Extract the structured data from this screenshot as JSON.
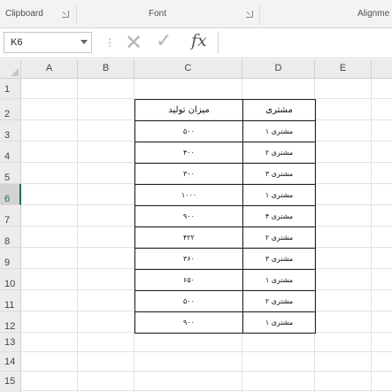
{
  "ribbon": {
    "groups": [
      "Clipboard",
      "Font",
      "Alignme"
    ]
  },
  "formula_bar": {
    "name_box": "K6",
    "cancel_symbol": "✕",
    "enter_symbol": "✓",
    "fx_label": "fx",
    "content": ""
  },
  "grid": {
    "columns": [
      "A",
      "B",
      "C",
      "D",
      "E"
    ],
    "rows": [
      "1",
      "2",
      "3",
      "4",
      "5",
      "6",
      "7",
      "8",
      "9",
      "10",
      "11",
      "12",
      "13",
      "14",
      "15"
    ],
    "active_row": "6"
  },
  "table": {
    "headers": {
      "production": "میزان تولید",
      "customer": "مشتری"
    },
    "rows": [
      {
        "production": "۵۰۰",
        "customer": "مشتری ۱"
      },
      {
        "production": "۴۰۰",
        "customer": "مشتری ۲"
      },
      {
        "production": "۳۰۰",
        "customer": "مشتری ۳"
      },
      {
        "production": "۱۰۰۰",
        "customer": "مشتری ۱"
      },
      {
        "production": "۹۰۰",
        "customer": "مشتری ۴"
      },
      {
        "production": "۴۲۲",
        "customer": "مشتری ۲"
      },
      {
        "production": "۳۶۰",
        "customer": "مشتری ۳"
      },
      {
        "production": "۶۵۰",
        "customer": "مشتری ۱"
      },
      {
        "production": "۵۰۰",
        "customer": "مشتری ۲"
      },
      {
        "production": "۹۰۰",
        "customer": "مشتری ۱"
      }
    ]
  },
  "colors": {
    "active_accent": "#217346",
    "header_bg": "#ececec",
    "grid_line": "#e1e1e1"
  }
}
